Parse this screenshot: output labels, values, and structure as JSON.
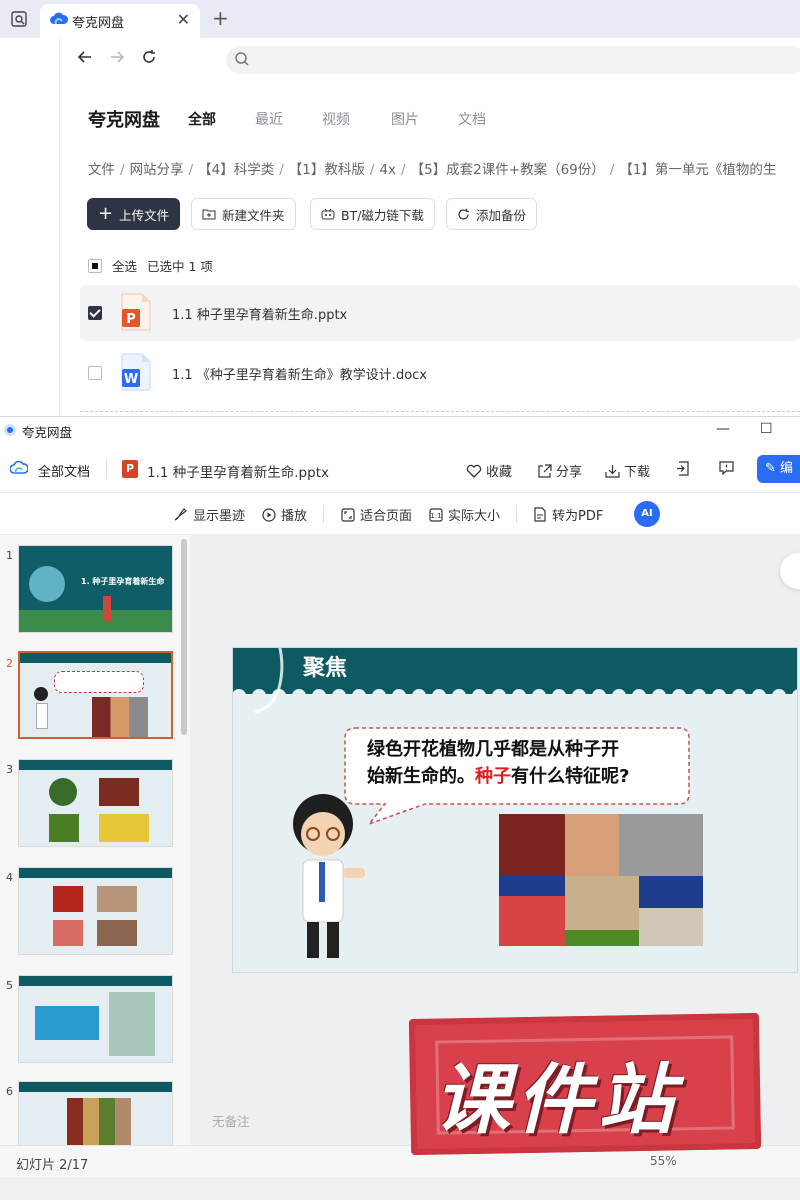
{
  "browser": {
    "tab_title": "夸克网盘",
    "close_glyph": "✕",
    "newtab_glyph": "+"
  },
  "pan": {
    "brand": "夸克网盘",
    "nav_tabs": [
      "全部",
      "最近",
      "视频",
      "图片",
      "文档"
    ],
    "breadcrumbs": [
      "文件",
      "网站分享",
      "【4】科学类",
      "【1】教科版",
      "4x",
      "【5】成套2课件+教案（69份）",
      "【1】第一单元《植物的生"
    ],
    "buttons": {
      "upload": "上传文件",
      "new_folder": "新建文件夹",
      "bt": "BT/磁力链下载",
      "backup": "添加备份"
    },
    "select_all": "全选",
    "selected_text": "已选中  1  项",
    "files": [
      {
        "name": "1.1 种子里孕育着新生命.pptx",
        "type": "pptx",
        "checked": true
      },
      {
        "name": "1.1 《种子里孕育着新生命》教学设计.docx",
        "type": "docx",
        "checked": false
      }
    ]
  },
  "viewer": {
    "window_title": "夸克网盘",
    "all_docs": "全部文档",
    "filename": "1.1 种子里孕育着新生命.pptx",
    "ppt_badge": "P",
    "actions": {
      "favorite": "收藏",
      "share": "分享",
      "download": "下载",
      "edit": "编"
    },
    "toolbar": {
      "ink": "显示墨迹",
      "play": "播放",
      "fit": "适合页面",
      "actual": "实际大小",
      "pdf": "转为PDF",
      "ai": "AI"
    },
    "thumb_numbers": [
      "1",
      "2",
      "3",
      "4",
      "5",
      "6"
    ],
    "slide": {
      "header": "聚焦",
      "bubble_line1": "绿色开花植物几乎都是从种子开",
      "bubble_line2a": "始新生命的。",
      "bubble_highlight": "种子",
      "bubble_line2b": "有什么特征呢?"
    },
    "thumb_title": "1. 种子里孕育着新生命",
    "notes": "无备注",
    "status": "幻灯片 2/17",
    "zoom": "55%"
  },
  "watermark": {
    "text": "课件站"
  },
  "colors": {
    "accent": "#2a6df4",
    "teal": "#0e5a62",
    "stamp": "#d8414b",
    "highlight": "#e0201a"
  }
}
